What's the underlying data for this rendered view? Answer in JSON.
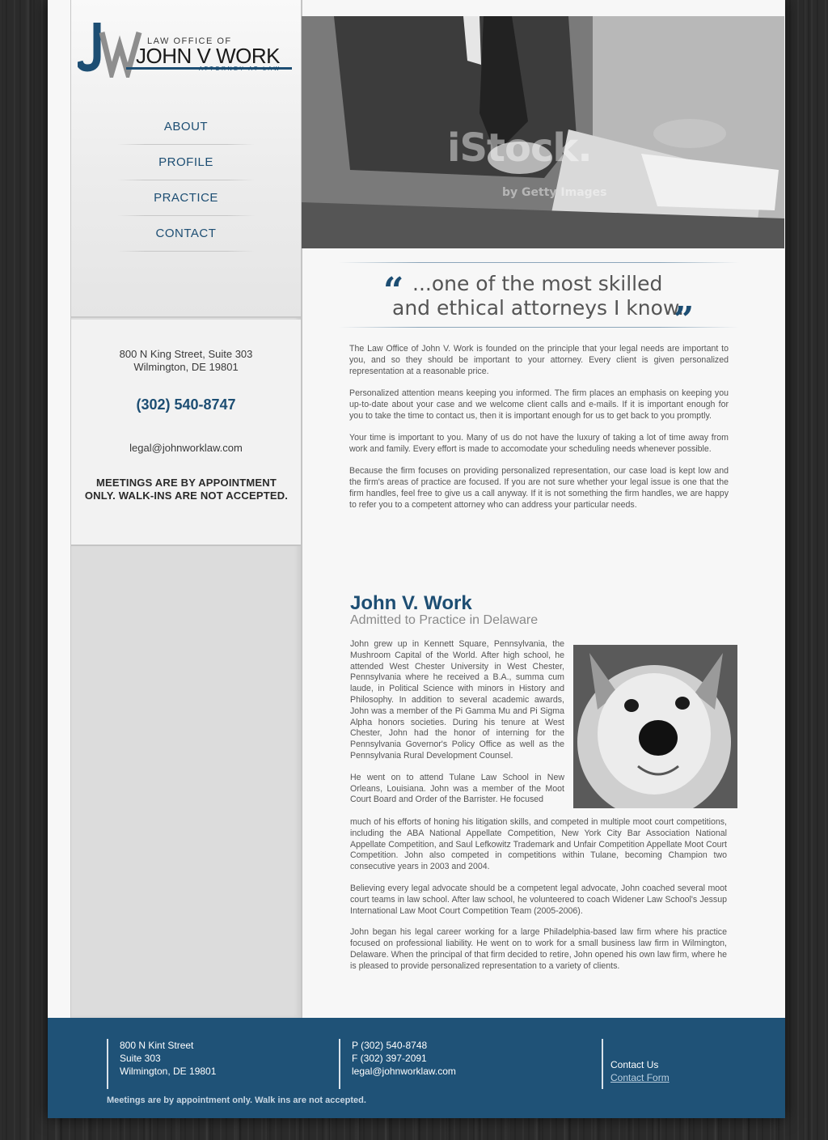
{
  "logo": {
    "monogram": "JW",
    "law_office": "LAW OFFICE OF",
    "name": "JOHN V WORK",
    "tagline": "ATTORNEY AT LAW"
  },
  "nav": {
    "items": [
      {
        "label": "ABOUT"
      },
      {
        "label": "PROFILE"
      },
      {
        "label": "PRACTICE"
      },
      {
        "label": "CONTACT"
      }
    ]
  },
  "sidebar": {
    "address_line1": "800 N King Street, Suite 303",
    "address_line2": "Wilmington, DE 19801",
    "phone": "(302) 540-8747",
    "email": "legal@johnworklaw.com",
    "notice_line1": "MEETINGS ARE BY APPOINTMENT",
    "notice_line2": "ONLY. WALK-INS ARE NOT ACCEPTED."
  },
  "hero": {
    "watermark": "iStock.",
    "watermark_sub": "by Getty Images"
  },
  "quote": {
    "open_mark": "“",
    "line1": "...one of the most skilled",
    "line2": "and ethical attorneys I know.",
    "close_mark": "”"
  },
  "intro": {
    "paragraphs": [
      "The Law Office of John V. Work is founded on the principle that your legal needs are important to you, and so they should be important to your attorney. Every client is given personalized representation at a reasonable price.",
      "Personalized attention means keeping you informed. The firm places an emphasis on keeping you up-to-date about your case and we welcome client calls and e-mails. If it is important enough for you to take the time to contact us, then it is important enough for us to get back to you promptly.",
      "Your time is important to you. Many of us do not have the luxury of taking a lot of time away from work and family. Every effort is made to accomodate your scheduling needs whenever possible.",
      "Because the firm focuses on providing personalized representation, our case load is kept low and the firm's areas of practice are focused. If you are not sure whether your legal issue is one that the firm handles, feel free to give us a call anyway. If it is not something the firm handles, we are happy to refer you to a competent attorney who can address your particular needs."
    ]
  },
  "bio": {
    "name": "John V. Work",
    "subtitle": "Admitted to Practice in Delaware",
    "p1": "John grew up in Kennett Square, Pennsylvania, the Mushroom Capital of the World. After high school, he attended West Chester University in West Chester, Pennsylvania where he received a B.A., summa cum laude, in Political Science with minors in History and Philosophy. In addition to several academic awards, John was a member of the Pi Gamma Mu and Pi Sigma Alpha honors societies. During his tenure at West Chester, John had the honor of interning for the Pennsylvania Governor's Policy Office as well as the Pennsylvania Rural Development Counsel.",
    "p2a": "He went on to attend Tulane Law School in New Orleans, Louisiana. John was a member of the Moot Court Board and Order of the Barrister. He focused",
    "p2b": "much of his efforts of honing his litigation skills, and competed in multiple moot court competitions, including the ABA National Appellate Competition, New York City Bar Association National Appellate Competition, and Saul Lefkowitz Trademark and Unfair Competition Appellate Moot Court Competition. John also competed in competitions within Tulane, becoming Champion two consecutive years in 2003 and 2004.",
    "p3": "Believing every legal advocate should be a competent legal advocate, John coached several moot court teams in law school. After law school, he volunteered to coach Widener Law School's Jessup International Law Moot Court Competition Team (2005-2006).",
    "p4": "John began his legal career working for a large Philadelphia-based law firm where his practice focused on professional liability. He went on to work for a small business law firm in Wilmington, Delaware. When the principal of that firm decided to retire, John opened his own law firm, where he is pleased to provide personalized representation to a variety of clients."
  },
  "footer": {
    "address1": "800 N Kint Street",
    "address2": "Suite 303",
    "address3": "Wilmington, DE 19801",
    "phone": "P (302) 540-8748",
    "fax": "F (302) 397-2091",
    "email": "legal@johnworklaw.com",
    "contact_label": "Contact Us",
    "contact_link": "Contact Form",
    "note": "Meetings are by appointment only. Walk ins are not accepted."
  },
  "colors": {
    "brand_blue": "#1d4e73",
    "footer_blue": "#1f5277"
  }
}
